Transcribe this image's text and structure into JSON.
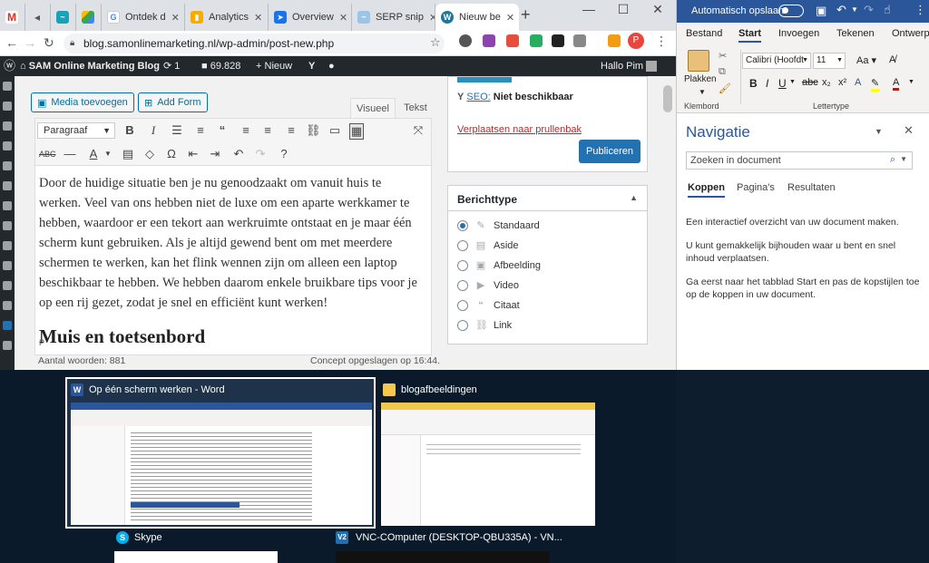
{
  "browser": {
    "tabs": [
      {
        "label": "",
        "icon": "gmail-icon"
      },
      {
        "label": "",
        "icon": "audio-icon"
      },
      {
        "label": "",
        "icon": "app-icon"
      },
      {
        "label": "",
        "icon": "drive-icon"
      },
      {
        "label": "Ontdek d",
        "icon": "google-icon"
      },
      {
        "label": "Analytics",
        "icon": "analytics-icon"
      },
      {
        "label": "Overview",
        "icon": "cursor-icon"
      },
      {
        "label": "SERP snip",
        "icon": "serp-icon"
      },
      {
        "label": "Nieuw be",
        "icon": "wordpress-icon"
      }
    ],
    "url": "blog.samonlinemarketing.nl/wp-admin/post-new.php",
    "profile_initial": "P"
  },
  "wp_adminbar": {
    "site_name": "SAM Online Marketing Blog",
    "updates": "1",
    "comments": "69.828",
    "new_label": "Nieuw",
    "greeting": "Hallo Pim"
  },
  "editor": {
    "media_button": "Media toevoegen",
    "form_button": "Add Form",
    "tab_visual": "Visueel",
    "tab_text": "Tekst",
    "format_select": "Paragraaf",
    "body_text": "Door de huidige situatie ben je nu genoodzaakt om vanuit huis te werken. Veel van ons hebben niet de luxe om een aparte werkkamer te hebben, waardoor er een tekort aan werkruimte ontstaat en je maar één scherm kunt gebruiken. Als je altijd gewend bent om met meerdere schermen te werken, kan het flink wennen zijn om alleen een laptop beschikbaar te hebben. We hebben daarom enkele bruikbare tips voor je op een rij gezet, zodat je snel en efficiënt kunt werken!",
    "heading": "Muis en toetsenbord",
    "path": "P",
    "word_count": "Aantal woorden: 881",
    "draft_saved": "Concept opgeslagen op 16:44."
  },
  "publish": {
    "seo_label": "SEO:",
    "seo_value": "Niet beschikbaar",
    "trash_link": "Verplaatsen naar prullenbak",
    "publish_button": "Publiceren"
  },
  "post_format": {
    "title": "Berichttype",
    "selected": "Standaard",
    "options": [
      "Standaard",
      "Aside",
      "Afbeelding",
      "Video",
      "Citaat",
      "Link"
    ]
  },
  "word": {
    "autosave": "Automatisch opslaan",
    "tabs": [
      "Bestand",
      "Start",
      "Invoegen",
      "Tekenen",
      "Ontwerp"
    ],
    "active_tab": "Start",
    "paste_label": "Plakken",
    "clipboard_label": "Klembord",
    "font_name": "Calibri (Hoofdt",
    "font_size": "11",
    "font_group_label": "Lettertype",
    "nav_title": "Navigatie",
    "search_placeholder": "Zoeken in document",
    "nav_tabs": [
      "Koppen",
      "Pagina's",
      "Resultaten"
    ],
    "nav_active_tab": "Koppen",
    "nav_help": [
      "Een interactief overzicht van uw document maken.",
      "U kunt gemakkelijk bijhouden waar u bent en snel inhoud verplaatsen.",
      "Ga eerst naar het tabblad Start en pas de kopstijlen toe op de koppen in uw document."
    ]
  },
  "task_switcher": {
    "windows": [
      {
        "title": "Op één scherm werken - Word",
        "icon": "word-icon"
      },
      {
        "title": "blogafbeeldingen",
        "icon": "folder-icon"
      },
      {
        "title": "Skype",
        "icon": "skype-icon"
      },
      {
        "title": "VNC-COmputer (DESKTOP-QBU335A) - VN...",
        "icon": "vnc-icon"
      }
    ]
  },
  "colors": {
    "wp_dark": "#23282d",
    "wp_blue": "#2271b1",
    "word_blue": "#2b579a",
    "trash_red": "#b32d2e",
    "switcher_bg": "#0b1a2a"
  }
}
